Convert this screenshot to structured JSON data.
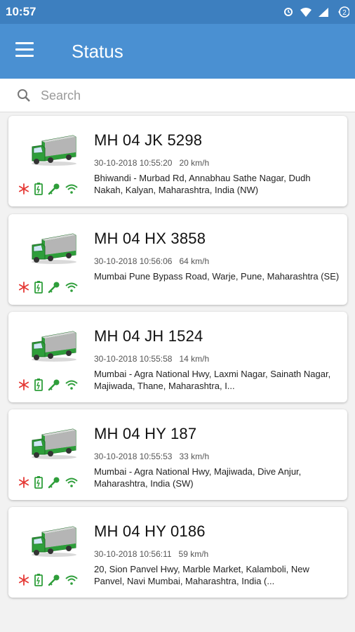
{
  "status_bar": {
    "time": "10:57"
  },
  "toolbar": {
    "title": "Status"
  },
  "search": {
    "placeholder": "Search",
    "value": ""
  },
  "colors": {
    "toolbar": "#4a90d2",
    "status_bar": "#3d7fbf",
    "truck_body": "#2e9e3a",
    "snowflake": "#e53935",
    "status_green": "#2e9e3a"
  },
  "vehicles": [
    {
      "plate": "MH 04 JK 5298",
      "datetime": "30-10-2018 10:55:20",
      "speed": "20 km/h",
      "address": "Bhiwandi - Murbad Rd,  Annabhau Sathe Nagar, Dudh Nakah,  Kalyan, Maharashtra,  India (NW)"
    },
    {
      "plate": "MH 04 HX 3858",
      "datetime": "30-10-2018 10:56:06",
      "speed": "64 km/h",
      "address": "Mumbai Pune Bypass Road, Warje, Pune, Maharashtra (SE)"
    },
    {
      "plate": "MH 04 JH 1524",
      "datetime": "30-10-2018 10:55:58",
      "speed": "14 km/h",
      "address": "Mumbai - Agra National Hwy,  Laxmi Nagar, Sainath Nagar,  Majiwada,  Thane, Maharashtra,  I..."
    },
    {
      "plate": "MH 04 HY 187",
      "datetime": "30-10-2018 10:55:53",
      "speed": "33 km/h",
      "address": "Mumbai - Agra National Hwy,  Majiwada,  Dive Anjur, Maharashtra,  India (SW)"
    },
    {
      "plate": "MH 04 HY 0186",
      "datetime": "30-10-2018 10:56:11",
      "speed": "59 km/h",
      "address": "20, Sion  Panvel Hwy, Marble Market, Kalamboli, New Panvel, Navi Mumbai, Maharashtra,  India (..."
    }
  ]
}
